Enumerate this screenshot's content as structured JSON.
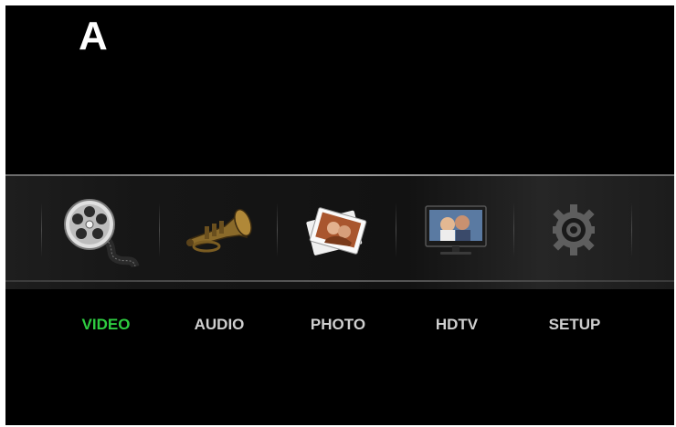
{
  "corner_label": "A",
  "menu": {
    "selected": "VIDEO",
    "items": [
      {
        "label": "VIDEO",
        "icon": "film-reel-icon",
        "active": true
      },
      {
        "label": "AUDIO",
        "icon": "trumpet-icon",
        "active": false
      },
      {
        "label": "PHOTO",
        "icon": "photo-stack-icon",
        "active": false
      },
      {
        "label": "HDTV",
        "icon": "tv-icon",
        "active": false
      },
      {
        "label": "SETUP",
        "icon": "gear-icon",
        "active": false
      }
    ]
  },
  "colors": {
    "background": "#000000",
    "active_label": "#2ecc40",
    "inactive_label": "#cfcfcf"
  }
}
